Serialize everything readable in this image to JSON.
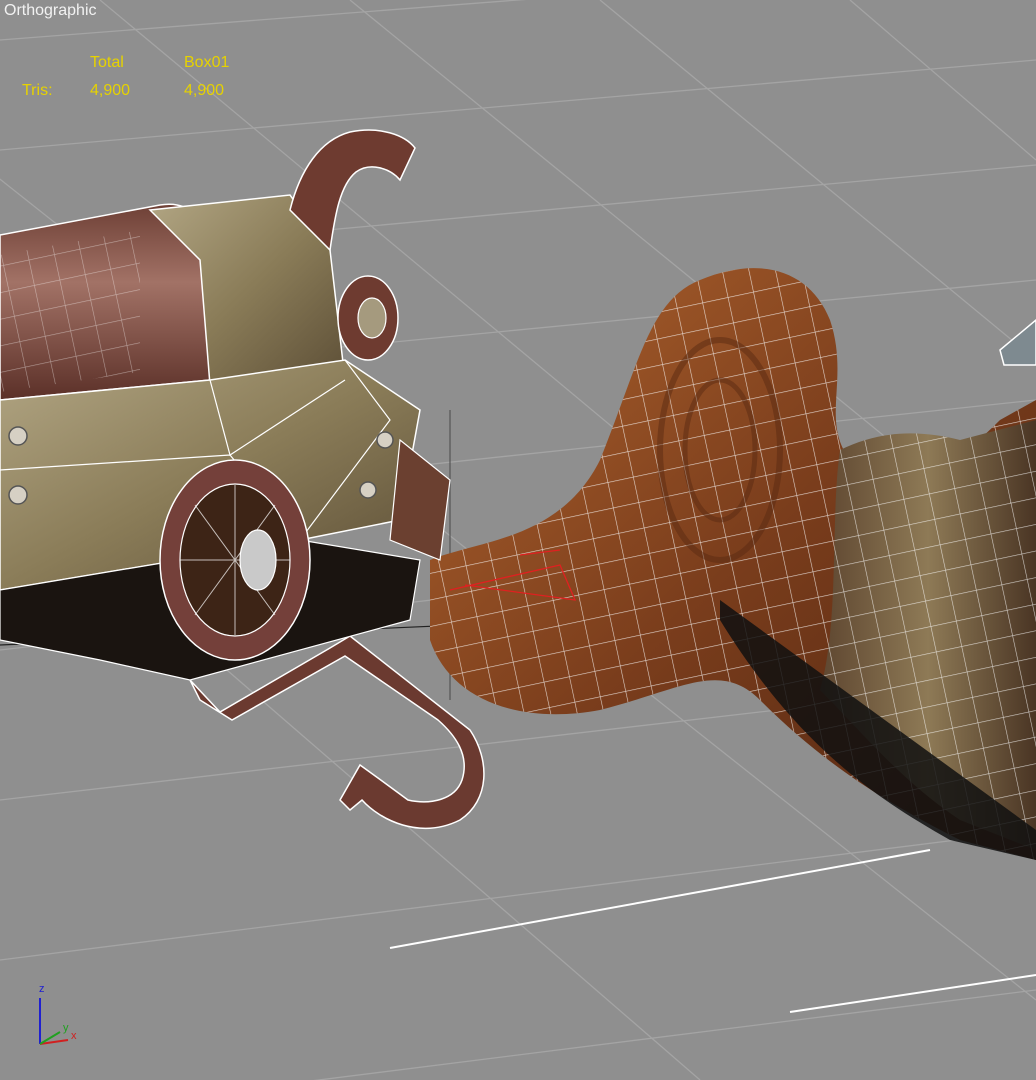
{
  "viewport": {
    "label": "Orthographic",
    "stats": {
      "col_total": "Total",
      "col_object": "Box01",
      "row_label": "Tris:",
      "total_value": "4,900",
      "object_value": "4,900"
    },
    "axis": {
      "z": "z",
      "x": "x",
      "y": "y"
    }
  },
  "colors": {
    "background": "#8f8f8f",
    "grid": "#a6a6a6",
    "wire": "#ffffff",
    "stats_text": "#e6d200",
    "wood": "#8a4a24",
    "metal": "#9a8c6a"
  }
}
